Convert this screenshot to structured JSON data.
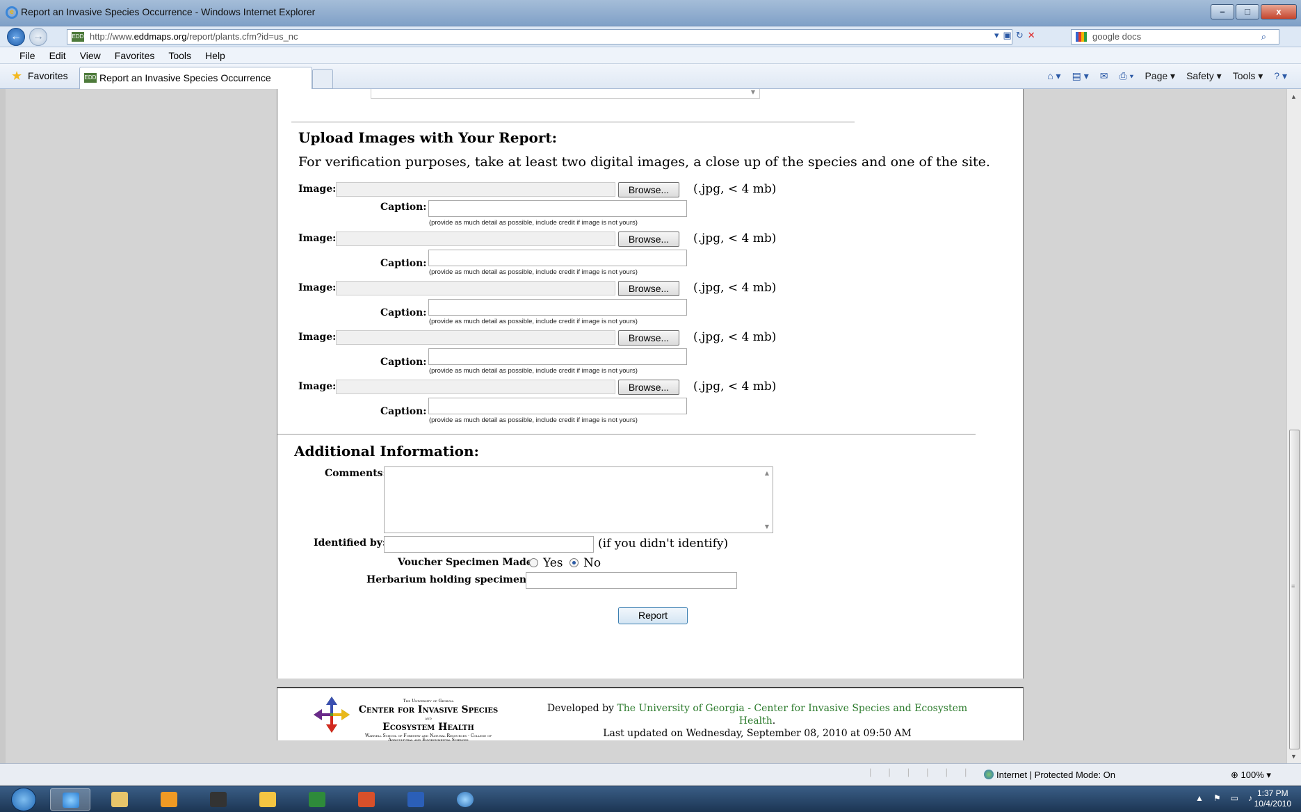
{
  "window": {
    "title": "Report an Invasive Species Occurrence - Windows Internet Explorer",
    "controls": {
      "minimize": "–",
      "maximize": "□",
      "close": "x"
    }
  },
  "address_bar": {
    "url_prefix": "http://www.",
    "url_domain": "eddmaps.org",
    "url_path": "/report/plants.cfm?id=us_nc",
    "search_text": "google docs"
  },
  "menu": [
    "File",
    "Edit",
    "View",
    "Favorites",
    "Tools",
    "Help"
  ],
  "favorites_bar": {
    "favorites_label": "Favorites",
    "tab_title": "Report an Invasive Species Occurrence",
    "commands": [
      "Page ▾",
      "Safety ▾",
      "Tools ▾"
    ]
  },
  "form": {
    "upload_heading": "Upload Images with Your Report:",
    "upload_intro": "For verification purposes, take at least two digital images, a close up of the species and one of the site.",
    "image_label": "Image:",
    "browse_label": "Browse...",
    "size_note": "(.jpg, < 4 mb)",
    "caption_label": "Caption:",
    "caption_help": "(provide as much detail as possible, include credit if image is not yours)",
    "additional_heading": "Additional Information:",
    "comments_label": "Comments:",
    "identified_by_label": "Identified by:",
    "identified_by_note": "(if you didn't identify)",
    "voucher_label": "Voucher Specimen Made:",
    "voucher_yes": "Yes",
    "voucher_no": "No",
    "voucher_selected": "No",
    "herbarium_label": "Herbarium holding specimen:",
    "report_button": "Report"
  },
  "footer": {
    "logo_top": "The University of Georgia",
    "logo_line1": "Center for Invasive Species",
    "logo_and": "and",
    "logo_line2": "Ecosystem Health",
    "logo_sub_left": "Warnell School of Forestry and Natural Resources",
    "logo_sub_right": "College of Agricultural and Environmental Sciences",
    "developed_prefix": "Developed by ",
    "developed_link": "The University of Georgia - Center for Invasive Species and Ecosystem Health",
    "developed_suffix": ".",
    "last_updated": "Last updated on Wednesday, September 08, 2010 at 09:50 AM"
  },
  "status_bar": {
    "zone": "Internet | Protected Mode: On",
    "zoom": "100%"
  },
  "taskbar": {
    "time": "1:37 PM",
    "date": "10/4/2010"
  }
}
